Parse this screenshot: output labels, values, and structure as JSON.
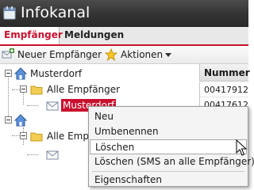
{
  "window": {
    "title": "Infokanal"
  },
  "tabs": [
    {
      "label": "Empfänger",
      "active": true
    },
    {
      "label": "Meldungen",
      "active": false
    }
  ],
  "toolbar": {
    "new_label": "Neuer Empfänger",
    "actions_label": "Aktionen"
  },
  "tree": {
    "root1": "Musterdorf",
    "group1": "Alle Empfänger",
    "selected_item": "Musterdorf",
    "group2": "Alle Empf"
  },
  "grid": {
    "header": "Nummer",
    "rows": [
      "00417912",
      "00417612"
    ]
  },
  "context_menu": {
    "items": [
      "Neu",
      "Umbenennen",
      "Löschen",
      "Löschen (SMS an alle Empfänger)",
      "Eigenschaften"
    ],
    "hovered": "Löschen"
  },
  "colors": {
    "accent": "#c8102e",
    "titlebar": "#333333"
  }
}
